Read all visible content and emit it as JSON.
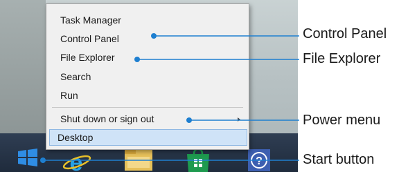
{
  "menu": {
    "items": [
      {
        "label": "Task Manager"
      },
      {
        "label": "Control Panel"
      },
      {
        "label": "File Explorer"
      },
      {
        "label": "Search"
      },
      {
        "label": "Run"
      },
      {
        "label": "Shut down or sign out"
      },
      {
        "label": "Desktop"
      }
    ],
    "highlighted_item": "Desktop"
  },
  "callouts": {
    "control_panel": "Control Panel",
    "file_explorer": "File Explorer",
    "power_menu": "Power menu",
    "start_button": "Start button"
  },
  "taskbar": {
    "apps": [
      {
        "icon": "internet-explorer-icon"
      },
      {
        "icon": "file-explorer-icon"
      },
      {
        "icon": "store-icon"
      },
      {
        "icon": "help-icon"
      }
    ]
  },
  "colors": {
    "callout_line": "#1e7fd0",
    "highlight_bg": "#cfe3f7",
    "taskbar_bg": "#24344a",
    "windows_logo": "#2f8de4"
  }
}
